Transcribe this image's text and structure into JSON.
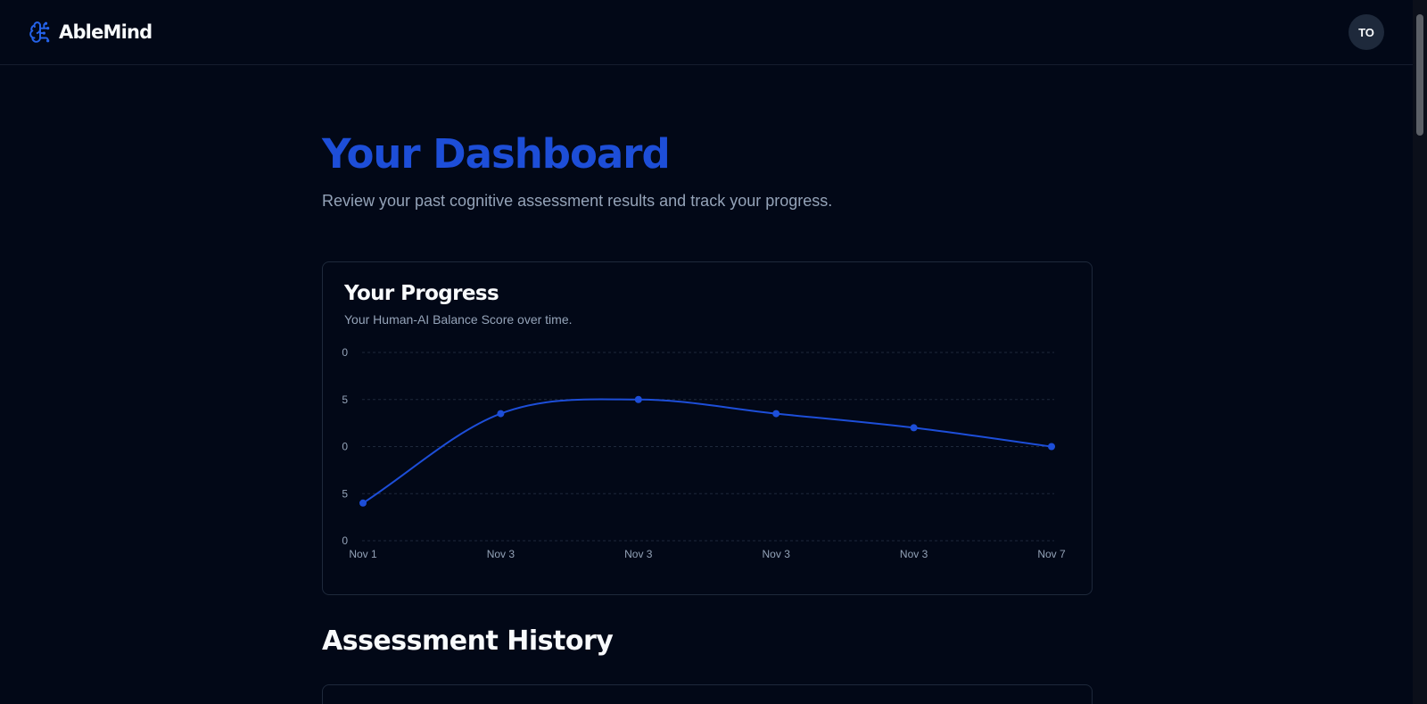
{
  "header": {
    "brand_name": "AbleMind",
    "avatar_initials": "TO"
  },
  "main": {
    "title": "Your Dashboard",
    "subtitle": "Review your past cognitive assessment results and track your progress.",
    "history_title": "Assessment History"
  },
  "progress_card": {
    "title": "Your Progress",
    "description": "Your Human-AI Balance Score over time."
  },
  "colors": {
    "accent": "#1d4ed8",
    "background": "#020817",
    "muted_text": "#94a3b8",
    "border": "#1e293b"
  },
  "chart_data": {
    "type": "line",
    "x": [
      "Nov 1",
      "Nov 3",
      "Nov 3",
      "Nov 3",
      "Nov 3",
      "Nov 7"
    ],
    "values": [
      4,
      13.5,
      15,
      13.5,
      12,
      10
    ],
    "y_ticks": [
      "0",
      "5",
      "0",
      "5",
      "0"
    ],
    "ylim": [
      0,
      20
    ],
    "grid": true,
    "curve": "smooth"
  }
}
